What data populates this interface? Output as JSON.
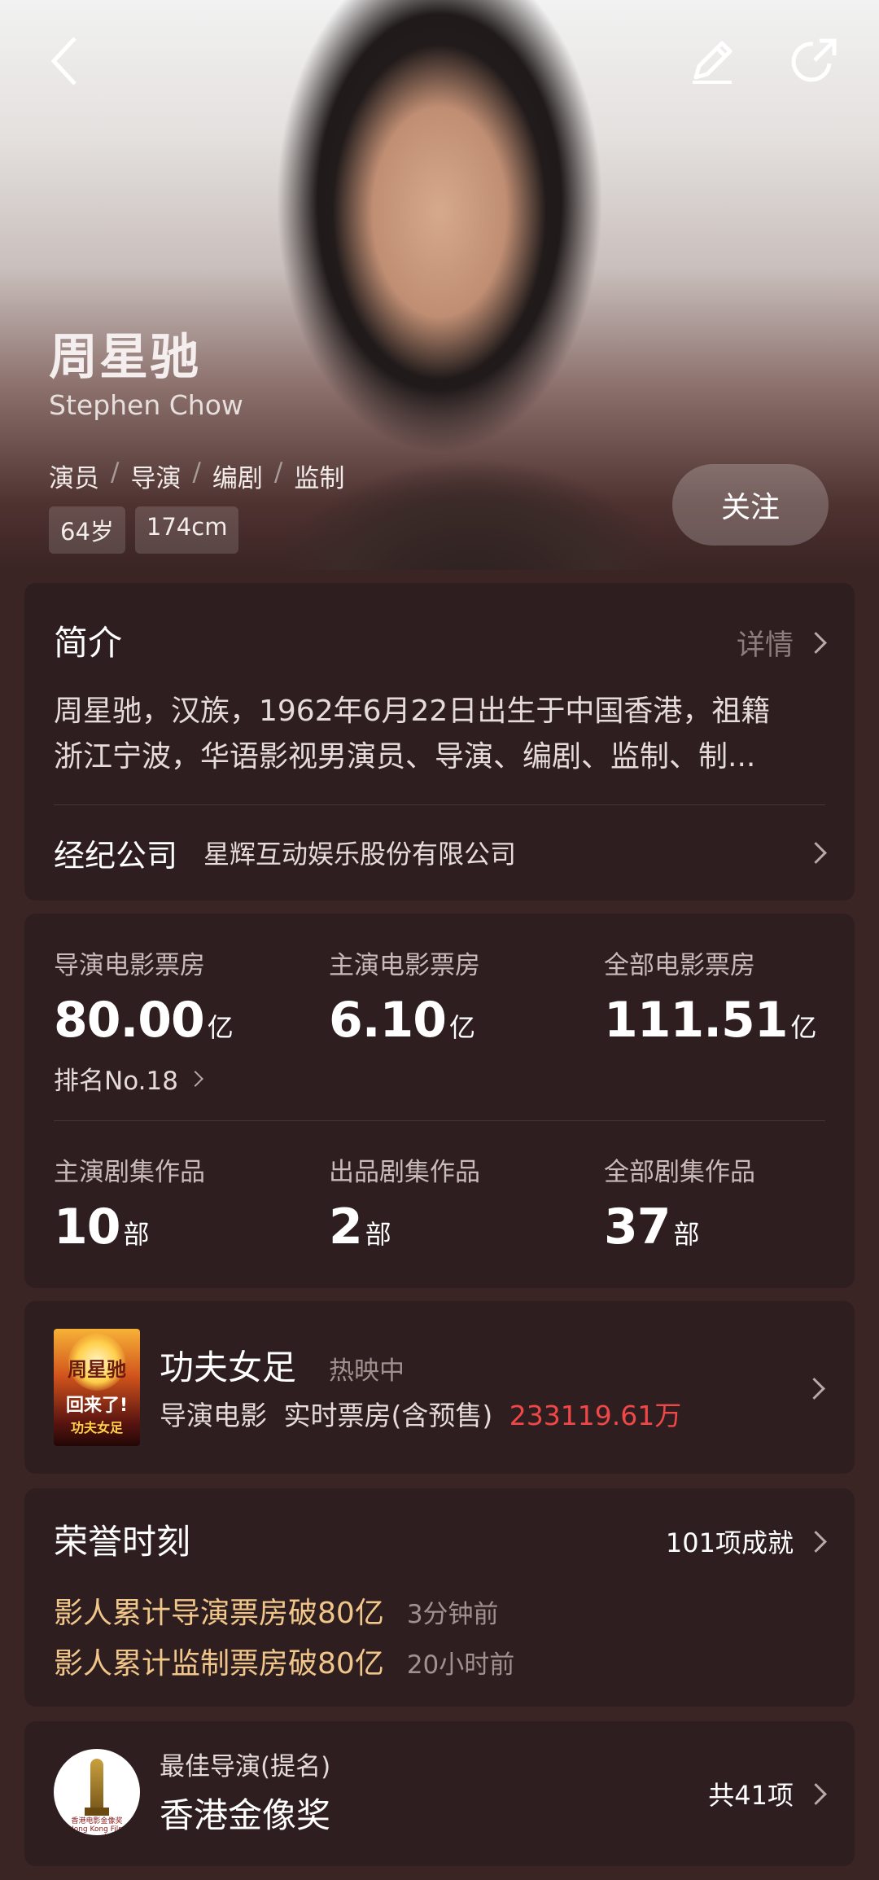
{
  "profile": {
    "name": "周星驰",
    "english_name": "Stephen Chow",
    "roles": [
      "演员",
      "导演",
      "编剧",
      "监制"
    ],
    "role_separator": "/",
    "age": "64岁",
    "height": "174cm",
    "follow_label": "关注"
  },
  "intro": {
    "title": "简介",
    "detail_label": "详情",
    "line1": "周星驰，汉族，1962年6月22日出生于中国香港，祖籍",
    "line2": "浙江宁波，华语影视男演员、导演、编剧、监制、制...",
    "agency_label": "经纪公司",
    "agency_name": "星辉互动娱乐股份有限公司"
  },
  "stats": {
    "director_box_label": "导演电影票房",
    "director_box_value": "80.00",
    "lead_box_label": "主演电影票房",
    "lead_box_value": "6.10",
    "all_box_label": "全部电影票房",
    "all_box_value": "111.51",
    "box_unit": "亿",
    "rank_label": "排名No.18",
    "lead_series_label": "主演剧集作品",
    "lead_series_value": "10",
    "produced_series_label": "出品剧集作品",
    "produced_series_value": "2",
    "all_series_label": "全部剧集作品",
    "all_series_value": "37",
    "series_unit": "部"
  },
  "movie": {
    "title": "功夫女足",
    "status": "热映中",
    "type": "导演电影",
    "box_label": "实时票房(含预售)",
    "box_value": "233119.61万",
    "poster_line1": "周星驰",
    "poster_line2": "回来了!",
    "poster_line3": "功夫女足"
  },
  "honors": {
    "title": "荣誉时刻",
    "count_label": "101项成就",
    "items": [
      {
        "prefix": "影人累计导演票房",
        "highlight": "破80亿",
        "time": "3分钟前"
      },
      {
        "prefix": "影人累计监制票房",
        "highlight": "破80亿",
        "time": "20小时前"
      }
    ]
  },
  "award": {
    "category": "最佳导演(提名)",
    "name": "香港金像奖",
    "count_label": "共41项",
    "badge_text": "香港电影金像奖 Hong Kong Film Awards"
  },
  "colors": {
    "background": "#3a2424",
    "card": "#2f1e1f",
    "honor_gold": "#f0c68a",
    "box_red": "#f04848"
  }
}
